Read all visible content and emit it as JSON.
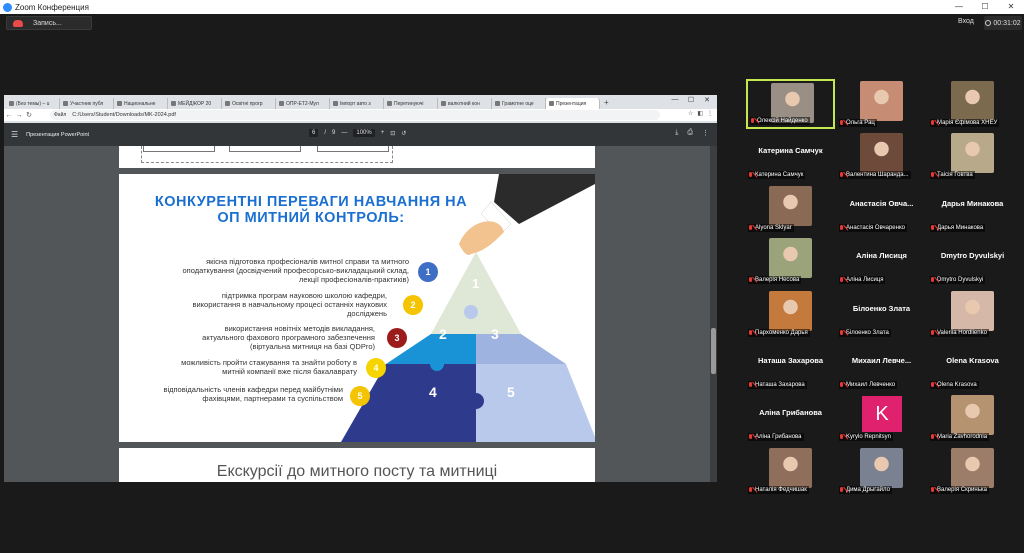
{
  "window": {
    "title": "Zoom Конференция",
    "controls": [
      "—",
      "☐",
      "✕"
    ]
  },
  "toolbar": {
    "record_label": "Запись...",
    "enter_label": "Вход",
    "timer": "00:31:02"
  },
  "browser": {
    "tabs": [
      {
        "label": "(Без темы) – u"
      },
      {
        "label": "Участник публ"
      },
      {
        "label": "Национальне"
      },
      {
        "label": "МЕЙДЖОР 20"
      },
      {
        "label": "Освітні прогр"
      },
      {
        "label": "ОПР-ЕТ2-Мул"
      },
      {
        "label": "Імпорт авто з"
      },
      {
        "label": "Перетинуючі"
      },
      {
        "label": "валютний кон"
      },
      {
        "label": "Грамотне оце"
      },
      {
        "label": "Презентация"
      }
    ],
    "new_tab": "+",
    "address_info": "Файл",
    "url": "C:/Users/Student/Downloads/MK-2024.pdf"
  },
  "pdf": {
    "doc_title": "Презентация PowerPoint",
    "page_current": "6",
    "page_sep": "/",
    "page_total": "9",
    "zoom": "100%",
    "minus": "—",
    "plus": "+"
  },
  "slide": {
    "title_line1": "КОНКУРЕНТНІ ПЕРЕВАГИ НАВЧАННЯ НА",
    "title_line2": "ОП МИТНИЙ КОНТРОЛЬ:",
    "items": [
      {
        "text_l1": "якісна підготовка професіоналів митної справи та митного",
        "text_l2": "оподаткування (досвідчений професорсько-викладацький склад,",
        "text_l3": "лекції професіоналів-практиків)",
        "num": "1",
        "color": "#3f6fc4"
      },
      {
        "text_l1": "підтримка програм науковою школою кафедри,",
        "text_l2": "використання в навчальному процесі останніх наукових",
        "text_l3": "досліджень",
        "num": "2",
        "color": "#f5c400"
      },
      {
        "text_l1": "використання новітніх методів викладання,",
        "text_l2": "актуального фахового програмного забезпечення",
        "text_l3": "(віртуальна митниця на базі QDPro)",
        "num": "3",
        "color": "#9c1b1b"
      },
      {
        "text_l1": "можливість пройти стажування та знайти роботу в",
        "text_l2": "митній компанії вже після бакалаврату",
        "text_l3": "",
        "num": "4",
        "color": "#f5d400"
      },
      {
        "text_l1": "відповідальність членів кафедри перед майбутніми",
        "text_l2": "фахівцями, партнерами та суспільством",
        "text_l3": "",
        "num": "5",
        "color": "#f5c400"
      }
    ],
    "pyramid": [
      "1",
      "2",
      "3",
      "4",
      "5"
    ],
    "colors": {
      "p1": "#dfe8d6",
      "p2": "#1a93d6",
      "p3": "#9fb3e0",
      "p4": "#2e3a8c",
      "p5": "#b9c9ec"
    }
  },
  "next_slide_heading": "Екскурсії до митного посту та митниці",
  "participants": [
    {
      "caption": "Олексій Найденко",
      "name_display": "",
      "photo": "#9a8f84"
    },
    {
      "caption": "Ольга Рац",
      "name_display": "",
      "photo": "#c78c74"
    },
    {
      "caption": "Марія Єфімова ХНЕУ",
      "name_display": "",
      "photo": "#7b6a4e"
    },
    {
      "caption": "Катерина Самчук",
      "name_display": "Катерина Самчук",
      "photo": ""
    },
    {
      "caption": "Валентина Шаранда...",
      "name_display": "",
      "photo": "#6d4a3a"
    },
    {
      "caption": "Таісія Говтва",
      "name_display": "",
      "photo": "#b7a98a"
    },
    {
      "caption": "Alyona Sklyar",
      "name_display": "",
      "photo": "#8a6a55"
    },
    {
      "caption": "Анастасія Овчаренко",
      "name_display": "Анастасія Овча...",
      "photo": ""
    },
    {
      "caption": "Дарья Минакова",
      "name_display": "Дарья Минакова",
      "photo": ""
    },
    {
      "caption": "Валерія Несова",
      "name_display": "",
      "photo": "#9aa37a"
    },
    {
      "caption": "Аліна Лисиця",
      "name_display": "Аліна Лисиця",
      "photo": ""
    },
    {
      "caption": "Dmytro Dyvulskyi",
      "name_display": "Dmytro Dyvulskyi",
      "photo": ""
    },
    {
      "caption": "Пархоменко Дарья",
      "name_display": "",
      "photo": "#c47a3c"
    },
    {
      "caption": "Білоенко Злата",
      "name_display": "Білоенко Злата",
      "photo": ""
    },
    {
      "caption": "Valeriia Hordiienko",
      "name_display": "",
      "photo": "#d6b8a8"
    },
    {
      "caption": "Наташа Захарова",
      "name_display": "Наташа Захарова",
      "photo": ""
    },
    {
      "caption": "Михаил Левченко",
      "name_display": "Михаил  Левче...",
      "photo": ""
    },
    {
      "caption": "Olena Krasova",
      "name_display": "Olena Krasova",
      "photo": ""
    },
    {
      "caption": "Аліна Грибанова",
      "name_display": "Аліна Грибанова",
      "photo": ""
    },
    {
      "caption": "Kyrylo Repnitsyn",
      "name_display": "",
      "photo": "",
      "initial": "K"
    },
    {
      "caption": "Maria Zavhorodnia",
      "name_display": "",
      "photo": "#b59270"
    },
    {
      "caption": "Наталія Федчишак",
      "name_display": "",
      "photo": "#8f6f5c"
    },
    {
      "caption": "Дима Дрыгайло",
      "name_display": "",
      "photo": "#7a8190"
    },
    {
      "caption": "Валерія Скринька",
      "name_display": "",
      "photo": "#9b7d6a"
    }
  ]
}
